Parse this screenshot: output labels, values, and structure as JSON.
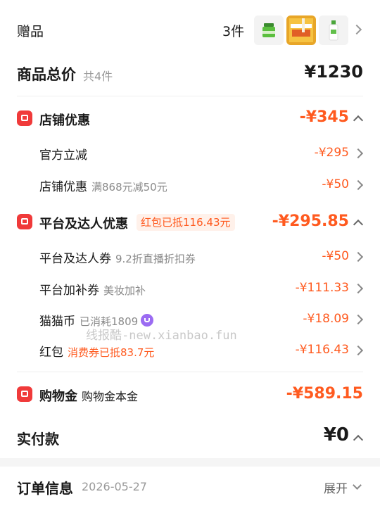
{
  "gift": {
    "label": "赠品",
    "count": "3件",
    "thumbnails": [
      "green-jar-product",
      "orange-box-product",
      "white-bottle-product"
    ]
  },
  "total": {
    "title": "商品总价",
    "subtitle": "共4件",
    "price": "¥1230"
  },
  "store_discount": {
    "icon": "store-icon",
    "title": "店铺优惠",
    "amount": "-¥345",
    "items": [
      {
        "label": "官方立减",
        "sub": "",
        "amount": "-¥295"
      },
      {
        "label": "店铺优惠",
        "sub": "满868元减50元",
        "amount": "-¥50"
      }
    ]
  },
  "platform_discount": {
    "icon": "coupon-icon",
    "title": "平台及达人优惠",
    "tag": "红包已抵116.43元",
    "amount": "-¥295.85",
    "items": [
      {
        "label": "平台及达人券",
        "sub": "9.2折直播折扣券",
        "amount": "-¥50"
      },
      {
        "label": "平台加补券",
        "sub": "美妆加补",
        "amount": "-¥111.33"
      },
      {
        "label": "猫猫币",
        "sub": "已消耗1809",
        "amount": "-¥18.09"
      },
      {
        "label": "红包",
        "sub": "消费券已抵83.7元",
        "amount": "-¥116.43"
      }
    ]
  },
  "watermark": "线报酷-new.xianbao.fun",
  "shopping_gold": {
    "icon": "bag-icon",
    "title": "购物金",
    "sub": "购物金本金",
    "amount": "-¥589.15"
  },
  "payment": {
    "label": "实付款",
    "amount": "¥0"
  },
  "order": {
    "title": "订单信息",
    "date": "2026-05-27",
    "expand": "展开"
  },
  "colors": {
    "accent": "#ff5a1f",
    "icon_red": "#f03a3a",
    "coin_purple": "#9b6bf2"
  }
}
